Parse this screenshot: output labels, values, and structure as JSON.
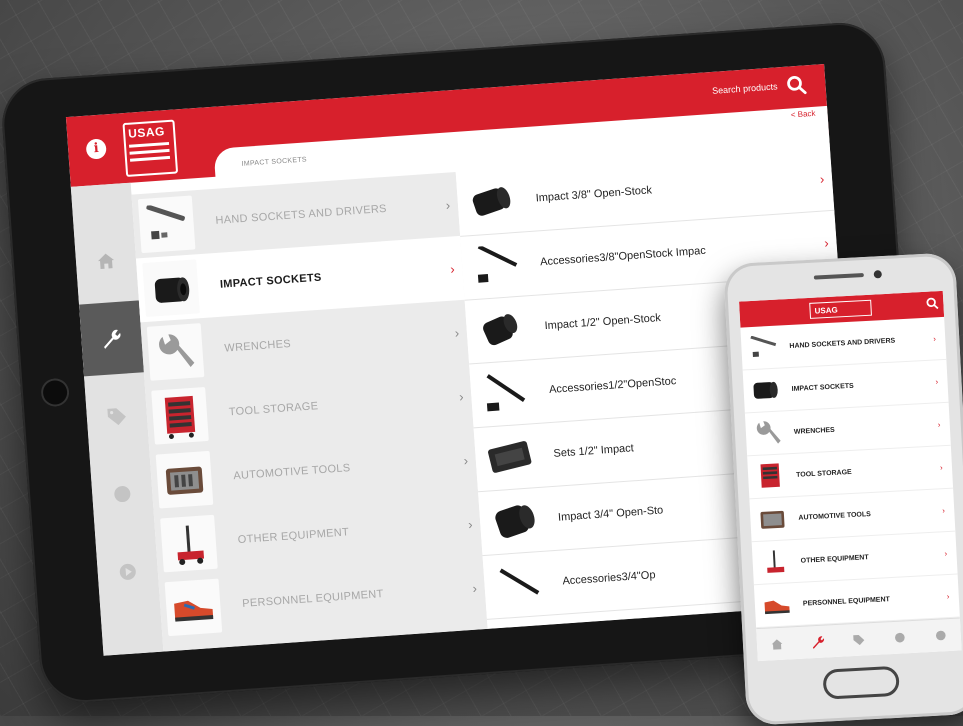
{
  "tablet": {
    "header": {
      "logo_text": "USAG",
      "search_label": "Search products",
      "back_label": "< Back",
      "breadcrumb": "IMPACT SOCKETS"
    },
    "rail": [
      {
        "icon": "home-icon",
        "active": false
      },
      {
        "icon": "wrench-icon",
        "active": true
      },
      {
        "icon": "tag-icon",
        "active": false
      },
      {
        "icon": "dot-icon",
        "active": false
      },
      {
        "icon": "play-icon",
        "active": false
      }
    ],
    "categories": [
      {
        "label": "HAND SOCKETS AND DRIVERS",
        "icon": "ratchet-icon",
        "active": false
      },
      {
        "label": "IMPACT SOCKETS",
        "icon": "socket-icon",
        "active": true
      },
      {
        "label": "WRENCHES",
        "icon": "wrench-icon",
        "active": false
      },
      {
        "label": "TOOL STORAGE",
        "icon": "tool-cabinet-icon",
        "active": false
      },
      {
        "label": "AUTOMOTIVE TOOLS",
        "icon": "toolcase-icon",
        "active": false
      },
      {
        "label": "OTHER EQUIPMENT",
        "icon": "jack-icon",
        "active": false
      },
      {
        "label": "PERSONNEL EQUIPMENT",
        "icon": "shoe-icon",
        "active": false
      }
    ],
    "products": [
      {
        "label": "Impact 3/8\" Open-Stock",
        "icon": "socket-icon"
      },
      {
        "label": "Accessories3/8\"OpenStock Impac",
        "icon": "extension-bar-icon"
      },
      {
        "label": "Impact 1/2\" Open-Stock",
        "icon": "socket-icon"
      },
      {
        "label": "Accessories1/2\"OpenStoc",
        "icon": "extension-bar-icon"
      },
      {
        "label": "Sets 1/2\" Impact",
        "icon": "case-icon"
      },
      {
        "label": "Impact 3/4\" Open-Sto",
        "icon": "socket-icon"
      },
      {
        "label": "Accessories3/4\"Op",
        "icon": "extension-bar-icon"
      }
    ]
  },
  "phone": {
    "logo_text": "USAG",
    "categories": [
      {
        "label": "HAND SOCKETS AND DRIVERS",
        "icon": "ratchet-icon"
      },
      {
        "label": "IMPACT SOCKETS",
        "icon": "socket-icon"
      },
      {
        "label": "WRENCHES",
        "icon": "wrench-icon"
      },
      {
        "label": "TOOL STORAGE",
        "icon": "tool-cabinet-icon"
      },
      {
        "label": "AUTOMOTIVE TOOLS",
        "icon": "toolcase-icon"
      },
      {
        "label": "OTHER EQUIPMENT",
        "icon": "jack-icon"
      },
      {
        "label": "PERSONNEL EQUIPMENT",
        "icon": "shoe-icon"
      }
    ],
    "nav": [
      "home-icon",
      "wrench-icon",
      "tag-icon",
      "dot-icon",
      "play-icon"
    ]
  },
  "colors": {
    "brand_red": "#d7202c",
    "rail_active": "#5a5a5a",
    "category_bg": "#ebebeb"
  }
}
